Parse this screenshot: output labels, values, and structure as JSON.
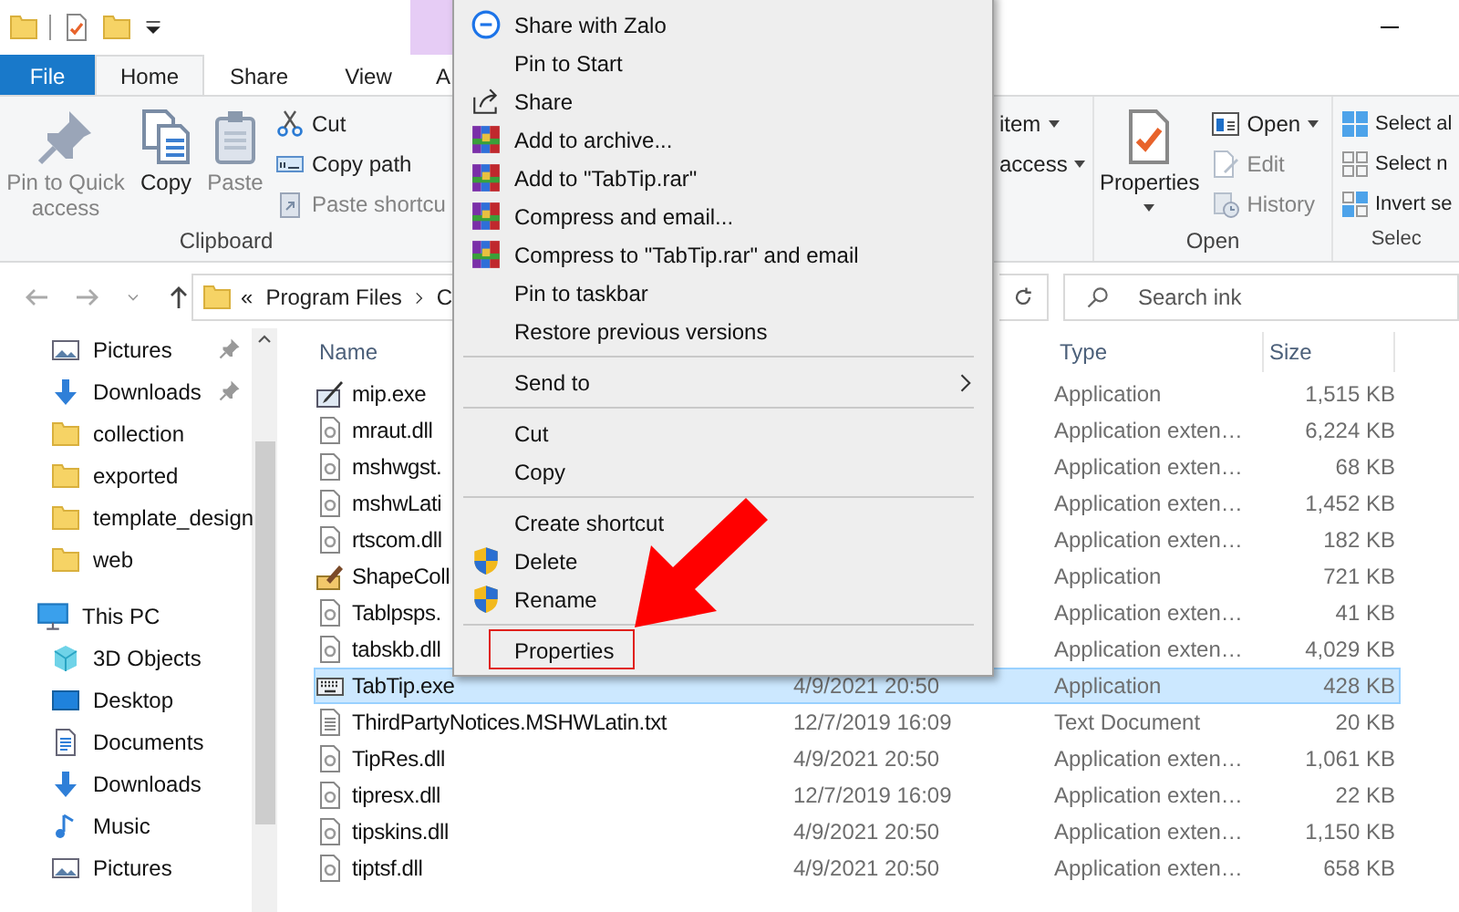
{
  "ribbon": {
    "tabs": [
      {
        "label": "File",
        "kind": "file",
        "selected": false
      },
      {
        "label": "Home",
        "kind": "tab",
        "selected": true
      },
      {
        "label": "Share",
        "kind": "tab",
        "selected": false
      },
      {
        "label": "View",
        "kind": "tab",
        "selected": false
      },
      {
        "label": "A",
        "kind": "tab",
        "selected": false
      }
    ],
    "groups": [
      {
        "label": "Clipboard",
        "items": [
          {
            "label": "Pin to Quick access",
            "kind": "large",
            "disabled": true,
            "dropdown": false
          },
          {
            "label": "Copy",
            "kind": "large",
            "disabled": false,
            "dropdown": false
          },
          {
            "label": "Paste",
            "kind": "large",
            "disabled": true,
            "dropdown": false
          },
          {
            "label": "Cut",
            "kind": "small",
            "disabled": false,
            "dropdown": false
          },
          {
            "label": "Copy path",
            "kind": "small",
            "disabled": false,
            "dropdown": false
          },
          {
            "label": "Paste shortcu",
            "kind": "small",
            "disabled": true,
            "dropdown": false
          }
        ]
      },
      {
        "items": [
          {
            "label": "item",
            "kind": "small",
            "disabled": false,
            "dropdown": true
          },
          {
            "label": "access",
            "kind": "small",
            "disabled": false,
            "dropdown": true
          }
        ]
      },
      {
        "label": "Open",
        "items": [
          {
            "label": "Properties",
            "kind": "large",
            "disabled": false,
            "dropdown": true
          },
          {
            "label": "Open",
            "kind": "small",
            "disabled": false,
            "dropdown": true
          },
          {
            "label": "Edit",
            "kind": "small",
            "disabled": true,
            "dropdown": false
          },
          {
            "label": "History",
            "kind": "small",
            "disabled": true,
            "dropdown": false
          }
        ]
      },
      {
        "label": "Selec",
        "items": [
          {
            "label": "Select al",
            "kind": "small",
            "disabled": false
          },
          {
            "label": "Select n",
            "kind": "small",
            "disabled": false
          },
          {
            "label": "Invert se",
            "kind": "small",
            "disabled": false
          }
        ]
      }
    ]
  },
  "address_bar": {
    "overflow": "«",
    "segments": [
      "Program Files",
      "C"
    ],
    "search": {
      "placeholder": "Search ink"
    }
  },
  "navigation_pane": {
    "quick_access": [
      {
        "label": "Pictures",
        "pinned": true
      },
      {
        "label": "Downloads",
        "pinned": true
      },
      {
        "label": "collection",
        "pinned": false
      },
      {
        "label": "exported",
        "pinned": false
      },
      {
        "label": "template_design",
        "pinned": false
      },
      {
        "label": "web",
        "pinned": false
      }
    ],
    "this_pc": {
      "label": "This PC",
      "children": [
        {
          "label": "3D Objects"
        },
        {
          "label": "Desktop"
        },
        {
          "label": "Documents"
        },
        {
          "label": "Downloads"
        },
        {
          "label": "Music"
        },
        {
          "label": "Pictures"
        }
      ]
    }
  },
  "file_list": {
    "columns": [
      {
        "label": "Name"
      },
      {
        "label": "Type"
      },
      {
        "label": "Size"
      }
    ],
    "rows": [
      {
        "name": "mip.exe",
        "type": "Application",
        "size": "1,515 KB",
        "selected": false
      },
      {
        "name": "mraut.dll",
        "type": "Application exten…",
        "size": "6,224 KB",
        "selected": false
      },
      {
        "name": "mshwgst.",
        "type": "Application exten…",
        "size": "68 KB",
        "selected": false
      },
      {
        "name": "mshwLati",
        "type": "Application exten…",
        "size": "1,452 KB",
        "selected": false
      },
      {
        "name": "rtscom.dll",
        "type": "Application exten…",
        "size": "182 KB",
        "selected": false
      },
      {
        "name": "ShapeColl",
        "type": "Application",
        "size": "721 KB",
        "selected": false
      },
      {
        "name": "Tablpsps.",
        "type": "Application exten…",
        "size": "41 KB",
        "selected": false
      },
      {
        "name": "tabskb.dll",
        "type": "Application exten…",
        "size": "4,029 KB",
        "selected": false
      },
      {
        "name": "TabTip.exe",
        "column_2": "4/9/2021 20:50",
        "type": "Application",
        "size": "428 KB",
        "selected": true
      },
      {
        "name": "ThirdPartyNotices.MSHWLatin.txt",
        "column_2": "12/7/2019 16:09",
        "type": "Text Document",
        "size": "20 KB",
        "selected": false
      },
      {
        "name": "TipRes.dll",
        "column_2": "4/9/2021 20:50",
        "type": "Application exten…",
        "size": "1,061 KB",
        "selected": false
      },
      {
        "name": "tipresx.dll",
        "column_2": "12/7/2019 16:09",
        "type": "Application exten…",
        "size": "22 KB",
        "selected": false
      },
      {
        "name": "tipskins.dll",
        "column_2": "4/9/2021 20:50",
        "type": "Application exten…",
        "size": "1,150 KB",
        "selected": false
      },
      {
        "name": "tiptsf.dll",
        "column_2": "4/9/2021 20:50",
        "type": "Application exten…",
        "size": "658 KB",
        "selected": false
      }
    ]
  },
  "context_menu": {
    "items": [
      {
        "kind": "item",
        "label": "Share with Zalo",
        "outlined": false
      },
      {
        "kind": "item",
        "label": "Pin to Start",
        "outlined": false
      },
      {
        "kind": "item",
        "label": "Share",
        "outlined": false
      },
      {
        "kind": "item",
        "label": "Add to archive...",
        "outlined": false
      },
      {
        "kind": "item",
        "label": "Add to \"TabTip.rar\"",
        "outlined": false
      },
      {
        "kind": "item",
        "label": "Compress and email...",
        "outlined": false
      },
      {
        "kind": "item",
        "label": "Compress to \"TabTip.rar\" and email",
        "outlined": false
      },
      {
        "kind": "item",
        "label": "Pin to taskbar",
        "outlined": false
      },
      {
        "kind": "item",
        "label": "Restore previous versions",
        "outlined": false
      },
      {
        "kind": "separator"
      },
      {
        "kind": "submenu",
        "label": "Send to",
        "outlined": false
      },
      {
        "kind": "separator"
      },
      {
        "kind": "item",
        "label": "Cut",
        "outlined": false
      },
      {
        "kind": "item",
        "label": "Copy",
        "outlined": false
      },
      {
        "kind": "separator"
      },
      {
        "kind": "item",
        "label": "Create shortcut",
        "outlined": false
      },
      {
        "kind": "item",
        "label": "Delete",
        "outlined": false
      },
      {
        "kind": "item",
        "label": "Rename",
        "outlined": false
      },
      {
        "kind": "separator"
      },
      {
        "kind": "item",
        "label": "Properties",
        "outlined": true
      }
    ]
  },
  "annotation": {
    "kind": "arrow"
  }
}
